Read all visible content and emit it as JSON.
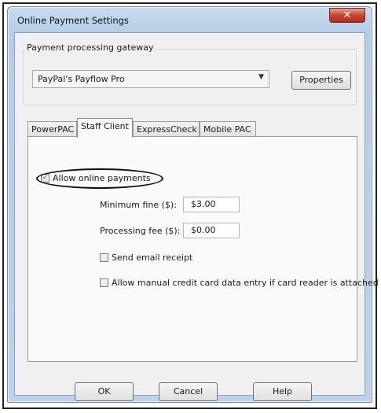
{
  "window": {
    "title": "Online Payment Settings",
    "close_glyph": "✕"
  },
  "gateway": {
    "group_label": "Payment processing gateway",
    "selected": "PayPal's Payflow Pro",
    "properties_label": "Properties"
  },
  "tabs": [
    {
      "label": "PowerPAC",
      "active": false
    },
    {
      "label": "Staff Client",
      "active": true
    },
    {
      "label": "ExpressCheck",
      "active": false
    },
    {
      "label": "Mobile PAC",
      "active": false
    }
  ],
  "staff_client": {
    "allow_online_payments": {
      "label": "Allow online payments",
      "checked": true
    },
    "minimum_fine": {
      "label": "Minimum fine ($):",
      "value": "$3.00"
    },
    "processing_fee": {
      "label": "Processing fee ($):",
      "value": "$0.00"
    },
    "send_email_receipt": {
      "label": "Send email receipt",
      "checked": false
    },
    "allow_manual_entry": {
      "label": "Allow manual credit card data entry if card reader is attached",
      "checked": false
    }
  },
  "footer": {
    "ok_label": "OK",
    "cancel_label": "Cancel",
    "help_label": "Help"
  },
  "colors": {
    "title_bar": "#c0d5ec",
    "close_button": "#c6432e",
    "check_mark": "#2a5d9c"
  },
  "icons": {
    "close": "close-icon",
    "dropdown": "chevron-down-icon",
    "check": "checkmark-icon"
  }
}
